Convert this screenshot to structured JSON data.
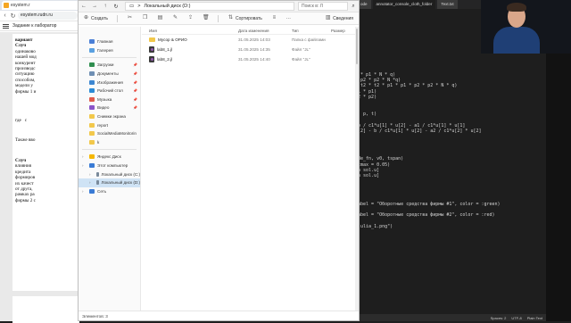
{
  "browser": {
    "tab_title": "esystem.r",
    "url": "esystem.rudn.ru",
    "doc_title": "Задание к лаборатор"
  },
  "document": {
    "lines": [
      {
        "text": "вариант",
        "bold": true
      },
      {
        "text": "Случ",
        "bold": true
      },
      {
        "text": "одинаково",
        "bold": false
      },
      {
        "text": "нашей мод",
        "bold": false
      },
      {
        "text": "конкурент",
        "bold": false
      },
      {
        "text": "производс",
        "bold": false
      },
      {
        "text": "ситуацию",
        "bold": false
      },
      {
        "text": "способом,",
        "bold": false
      },
      {
        "text": "модели у",
        "bold": false
      },
      {
        "text": "фирмы 1 и",
        "bold": false
      }
    ],
    "mid_label": "где",
    "mid_sub": "c",
    "also_line": "Также вво",
    "lines2": [
      {
        "text": "Случ",
        "bold": true
      },
      {
        "text": "влияния",
        "bold": false
      },
      {
        "text": "кредита",
        "bold": false
      },
      {
        "text": "формиров",
        "bold": false
      },
      {
        "text": "их качест",
        "bold": false
      },
      {
        "text": "от друга,",
        "bold": false
      },
      {
        "text": "рамках ра",
        "bold": false
      },
      {
        "text": "фирмы 2 с",
        "bold": false
      }
    ]
  },
  "editor": {
    "tabs": [
      "ode",
      "annotator_console_cloth_folder",
      "Text.txt"
    ],
    "code_lines": [
      "",
      "",
      "",
      "* * p1 * N * q)",
      "* p2 * p2 * N *q)",
      "* t2 * t2 * p1 * p1 * p2 * p2 * N * q)",
      "t1 * p1)",
      "t2 * p2)",
      "",
      "",
      "u, p, t)",
      "",
      " b / c1*u[1] * u[2] - a1 / c1*u[1] * u[1]",
      "u[2] - b / c1*u[1] * u[2] - a2 / c1*u[2] * u[2]",
      "",
      "",
      "",
      ")",
      "ode_fn, v0, tspan)",
      "dtmax = 0.05)",
      "in sol.u]",
      "in sol.u]",
      "t]",
      "",
      "",
      "",
      "label = \"Оборотные средства фирмы #1\", color = :green)",
      "",
      "label = \"Оборотные средства фирмы #2\", color = :red)",
      "",
      "_julia_1.png\")"
    ],
    "status": [
      "Spaces: 2",
      "UTF-8",
      "Plain Text"
    ]
  },
  "explorer": {
    "back": "←",
    "forward": "→",
    "up": "↑",
    "refresh": "↻",
    "path": [
      "Локальный диск (D:)",
      ">"
    ],
    "search_placeholder": "Поиск в: Л",
    "toolbar": {
      "create": "Создать",
      "sort": "Сортировать",
      "view": "Просмотреть",
      "more": "···",
      "details": "Сведения"
    },
    "columns": {
      "name": "Имя",
      "date": "Дата изменения",
      "type": "Тип",
      "size": "Размер"
    },
    "files": [
      {
        "name": "Мусор & ОРИО",
        "date": "31.05.2025 14:03",
        "type": "Папка с файлами",
        "size": "",
        "icon": "folder"
      },
      {
        "name": "lab8_1.jl",
        "date": "31.05.2025 14:35",
        "type": "Файл \"JL\"",
        "size": "",
        "icon": "julia"
      },
      {
        "name": "lab8_2.jl",
        "date": "31.05.2025 14:40",
        "type": "Файл \"JL\"",
        "size": "",
        "icon": "julia"
      }
    ],
    "nav": [
      {
        "label": "Главная",
        "icon": "home",
        "color": "#4a7fd6",
        "pin": false
      },
      {
        "label": "Галерея",
        "icon": "gallery",
        "color": "#5aa0e0",
        "pin": false
      },
      {
        "sep": true
      },
      {
        "label": "Загрузки",
        "icon": "downloads",
        "color": "#2f8e4f",
        "pin": true
      },
      {
        "label": "Документы",
        "icon": "documents",
        "color": "#6f8fb3",
        "pin": true
      },
      {
        "label": "Изображения",
        "icon": "pictures",
        "color": "#3d87d1",
        "pin": true
      },
      {
        "label": "Рабочий стол",
        "icon": "desktop",
        "color": "#2b8bd6",
        "pin": true
      },
      {
        "label": "Музыка",
        "icon": "music",
        "color": "#e05b4b",
        "pin": true
      },
      {
        "label": "Видео",
        "icon": "video",
        "color": "#8b55c9",
        "pin": true
      },
      {
        "label": "Снимки экрана",
        "icon": "folder",
        "color": "#f2c84b",
        "pin": false
      },
      {
        "label": "report",
        "icon": "folder",
        "color": "#f2c84b",
        "pin": false
      },
      {
        "label": "SocialMediaMonitorin",
        "icon": "folder",
        "color": "#f2c84b",
        "pin": false
      },
      {
        "label": "k",
        "icon": "folder",
        "color": "#f2c84b",
        "pin": false
      },
      {
        "sep": true
      },
      {
        "label": "Яндекс Диск",
        "icon": "cloud",
        "color": "#f5b700",
        "chev": true
      },
      {
        "label": "Этот компьютер",
        "icon": "pc",
        "color": "#3a7bd5",
        "chev": true,
        "expanded": true
      },
      {
        "label": "Локальный диск (C:)",
        "icon": "drive",
        "color": "#7a8a9a",
        "chev": true,
        "indent": true
      },
      {
        "label": "Локальный диск (D:)",
        "icon": "drive",
        "color": "#7a8a9a",
        "chev": true,
        "indent": true,
        "active": true
      },
      {
        "label": "Сеть",
        "icon": "network",
        "color": "#3a7bd5",
        "chev": true
      }
    ],
    "status": "Элементов: 3"
  }
}
